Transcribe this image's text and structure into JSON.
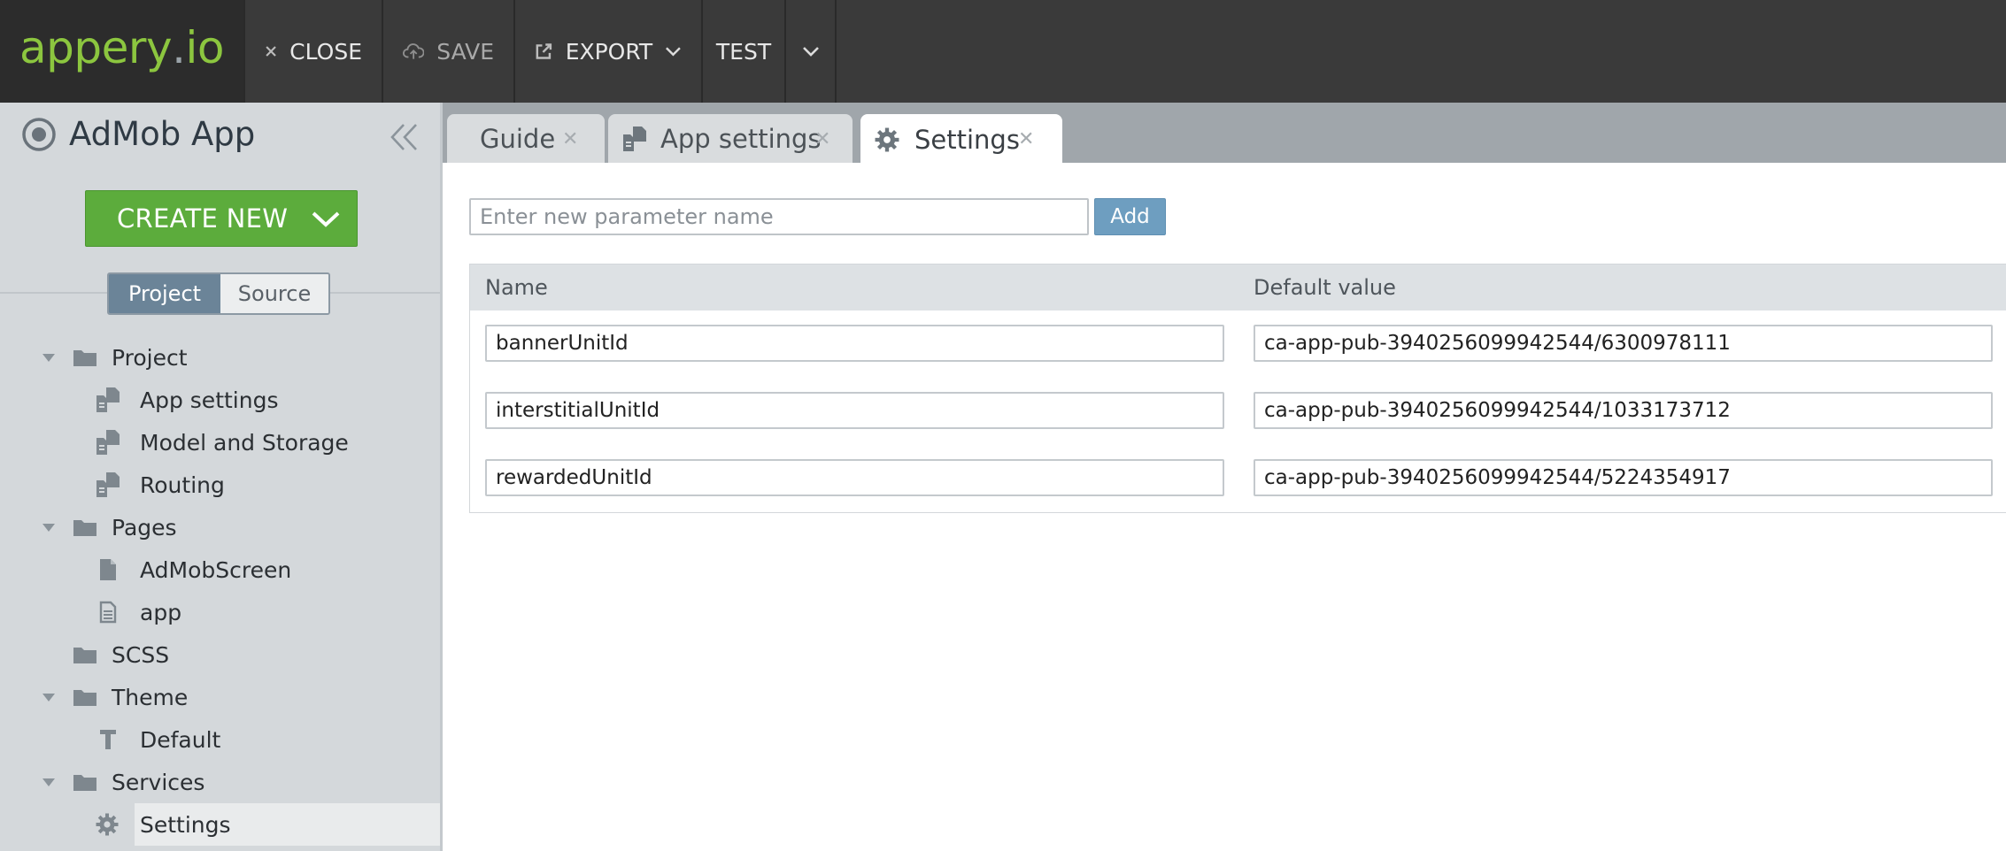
{
  "topbar": {
    "logo": {
      "part1": "appery",
      "part2": ".",
      "part3": "io"
    },
    "close_label": "CLOSE",
    "save_label": "SAVE",
    "export_label": "EXPORT",
    "test_label": "TEST"
  },
  "sidebar": {
    "project_title": "AdMob App",
    "create_new_label": "CREATE NEW",
    "toggle": {
      "project": "Project",
      "source": "Source"
    },
    "tree": [
      {
        "label": "Project",
        "icon": "folder-icon",
        "expanded": true
      },
      {
        "label": "App settings",
        "icon": "settings-file-icon"
      },
      {
        "label": "Model and Storage",
        "icon": "settings-file-icon"
      },
      {
        "label": "Routing",
        "icon": "settings-file-icon"
      },
      {
        "label": "Pages",
        "icon": "folder-icon",
        "expanded": true
      },
      {
        "label": "AdMobScreen",
        "icon": "page-icon"
      },
      {
        "label": "app",
        "icon": "page-outline-icon"
      },
      {
        "label": "SCSS",
        "icon": "folder-icon"
      },
      {
        "label": "Theme",
        "icon": "folder-icon",
        "expanded": true
      },
      {
        "label": "Default",
        "icon": "theme-t-icon"
      },
      {
        "label": "Services",
        "icon": "folder-icon",
        "expanded": true
      },
      {
        "label": "Settings",
        "icon": "gear-icon",
        "selected": true
      }
    ]
  },
  "tabs": [
    {
      "label": "Guide"
    },
    {
      "label": "App settings"
    },
    {
      "label": "Settings",
      "active": true
    }
  ],
  "settings": {
    "new_param_placeholder": "Enter new parameter name",
    "add_label": "Add",
    "columns": {
      "name": "Name",
      "default_value": "Default value"
    },
    "rows": [
      {
        "name": "bannerUnitId",
        "value": "ca-app-pub-3940256099942544/6300978111"
      },
      {
        "name": "interstitialUnitId",
        "value": "ca-app-pub-3940256099942544/1033173712"
      },
      {
        "name": "rewardedUnitId",
        "value": "ca-app-pub-3940256099942544/5224354917"
      }
    ]
  },
  "colors": {
    "topbar": "#3a3a3a",
    "brand_green": "#8cc63f",
    "create_button": "#5cac3c",
    "toggle_active": "#6b8498",
    "add_button": "#6e9ec0"
  }
}
